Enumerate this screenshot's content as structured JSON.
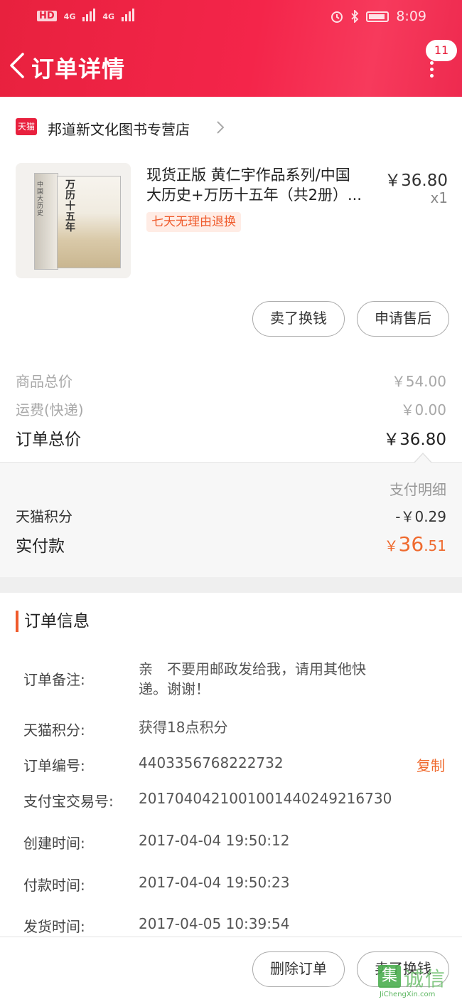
{
  "status_bar": {
    "hd": "HD",
    "net1": "4G",
    "net2": "4G",
    "time": "8:09"
  },
  "header": {
    "title": "订单详情",
    "badge_count": "11"
  },
  "shop": {
    "platform_label": "天猫",
    "name": "邦道新文化图书专营店"
  },
  "product": {
    "cover_title": "万历十五年",
    "cover_spine": "中国大历史",
    "title_line1": "现货正版 黄仁宇作品系列/中国",
    "title_line2": "大历史+万历十五年（共2册）...",
    "price": "￥36.80",
    "quantity": "x1",
    "tag": "七天无理由退换"
  },
  "item_actions": {
    "sell": "卖了换钱",
    "after_sale": "申请售后"
  },
  "summary": {
    "goods_total_label": "商品总价",
    "goods_total": "￥54.00",
    "shipping_label": "运费(快递)",
    "shipping": "￥0.00",
    "order_total_label": "订单总价",
    "order_total": "￥36.80"
  },
  "payment": {
    "detail_label": "支付明细",
    "points_label": "天猫积分",
    "points_value": "-￥0.29",
    "paid_label": "实付款",
    "paid_yen": "￥",
    "paid_int": "36",
    "paid_dec": ".51"
  },
  "order_info": {
    "heading": "订单信息",
    "remark_label": "订单备注:",
    "remark_line1": "亲　不要用邮政发给我，请用其他快",
    "remark_line2": "递。谢谢！",
    "points_label": "天猫积分:",
    "points_value": "获得18点积分",
    "order_no_label": "订单编号:",
    "order_no": "4403356768222732",
    "copy": "复制",
    "alipay_label": "支付宝交易号:",
    "alipay_no": "2017040421001001440249216730",
    "created_label": "创建时间:",
    "created": "2017-04-04 19:50:12",
    "paid_label": "付款时间:",
    "paid": "2017-04-04 19:50:23",
    "shipped_label": "发货时间:",
    "shipped": "2017-04-05 10:39:54"
  },
  "bottom_actions": {
    "delete": "删除订单",
    "sell": "卖了换钱"
  },
  "watermark": {
    "mark": "集",
    "text": "诚信",
    "url": "JiChengXin.com"
  },
  "colors": {
    "header_red": "#e8213e",
    "accent_orange": "#ef6a2e"
  }
}
